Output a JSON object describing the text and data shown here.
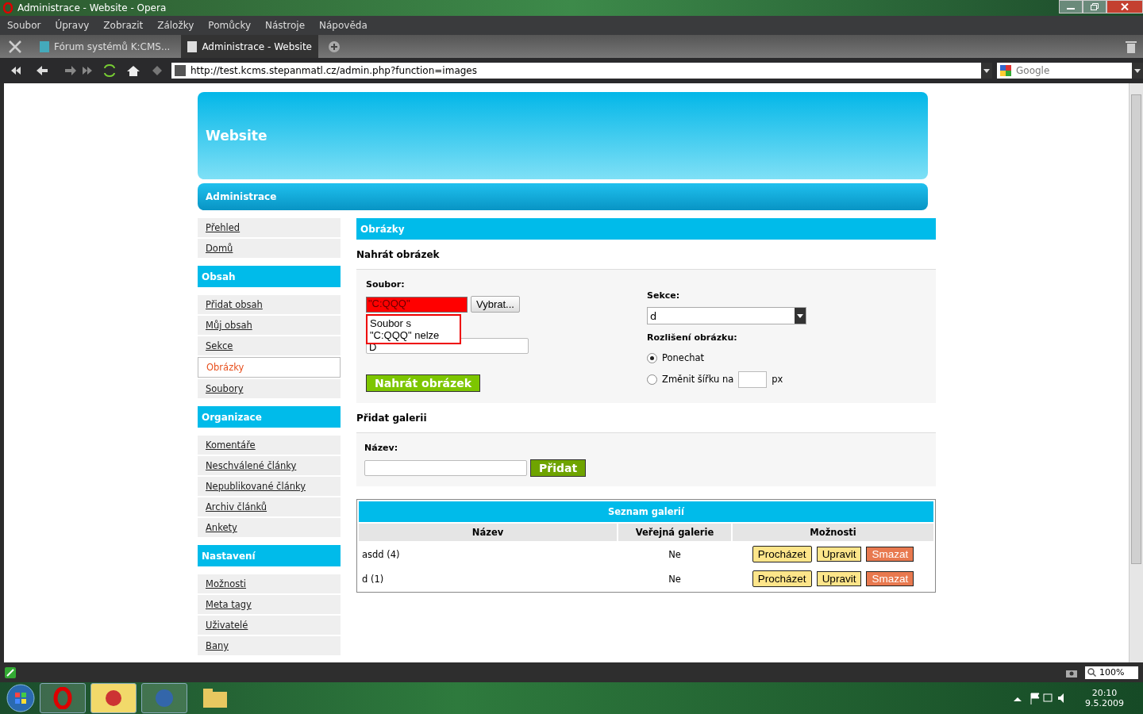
{
  "window": {
    "title": "Administrace - Website - Opera"
  },
  "menu": [
    "Soubor",
    "Úpravy",
    "Zobrazit",
    "Záložky",
    "Pomůcky",
    "Nástroje",
    "Nápověda"
  ],
  "tabs": [
    {
      "label": "Fórum systémů K:CMS...",
      "selected": false
    },
    {
      "label": "Administrace - Website",
      "selected": true
    }
  ],
  "address": {
    "url": "http://test.kcms.stepanmatl.cz/admin.php?function=images",
    "search_placeholder": "Google"
  },
  "header": {
    "title": "Website",
    "nav": "Administrace"
  },
  "sidebar": [
    {
      "items": [
        {
          "label": "Přehled",
          "selected": false
        },
        {
          "label": "Domů",
          "selected": false
        }
      ]
    },
    {
      "heading": "Obsah",
      "items": [
        {
          "label": "Přidat obsah",
          "selected": false
        },
        {
          "label": "Můj obsah",
          "selected": false
        },
        {
          "label": "Sekce",
          "selected": false
        },
        {
          "label": "Obrázky",
          "selected": true
        },
        {
          "label": "Soubory",
          "selected": false
        }
      ]
    },
    {
      "heading": "Organizace",
      "items": [
        {
          "label": "Komentáře",
          "selected": false
        },
        {
          "label": "Neschválené články",
          "selected": false
        },
        {
          "label": "Nepublikované články",
          "selected": false
        },
        {
          "label": "Archiv článků",
          "selected": false
        },
        {
          "label": "Ankety",
          "selected": false
        }
      ]
    },
    {
      "heading": "Nastavení",
      "items": [
        {
          "label": "Možnosti",
          "selected": false
        },
        {
          "label": "Meta tagy",
          "selected": false
        },
        {
          "label": "Uživatelé",
          "selected": false
        },
        {
          "label": "Bany",
          "selected": false
        }
      ]
    }
  ],
  "main": {
    "title": "Obrázky",
    "upload": {
      "heading": "Nahrát obrázek",
      "file_label": "Soubor:",
      "file_value": "\"C:QQQ\"",
      "browse": "Vybrat...",
      "error_lines": [
        "Soubor s",
        "\"C:QQQ\" nelze"
      ],
      "name_value": "D",
      "submit": "Nahrát obrázek",
      "section_label": "Sekce:",
      "section_value": "d",
      "resolution_label": "Rozlišení obrázku:",
      "options": [
        {
          "label": "Ponechat",
          "selected": true,
          "kind": "plain"
        },
        {
          "label": "Změnit šířku na",
          "selected": false,
          "kind": "width",
          "unit": "px"
        }
      ]
    },
    "gallery": {
      "heading": "Přidat galerii",
      "name_label": "Název:",
      "submit": "Přidat"
    },
    "table": {
      "caption": "Seznam galerií",
      "columns": [
        "Název",
        "Veřejná galerie",
        "Možnosti"
      ],
      "rows": [
        {
          "name": "asdd (4)",
          "public": "Ne",
          "actions": [
            {
              "label": "Procházet",
              "kind": "browse"
            },
            {
              "label": "Upravit",
              "kind": "edit"
            },
            {
              "label": "Smazat",
              "kind": "delete"
            }
          ]
        },
        {
          "name": "d (1)",
          "public": "Ne",
          "actions": [
            {
              "label": "Procházet",
              "kind": "browse"
            },
            {
              "label": "Upravit",
              "kind": "edit"
            },
            {
              "label": "Smazat",
              "kind": "delete"
            }
          ]
        }
      ]
    }
  },
  "status_bar": {
    "zoom": "100%"
  },
  "taskbar": {
    "time": "20:10",
    "date": "9.5.2009"
  }
}
